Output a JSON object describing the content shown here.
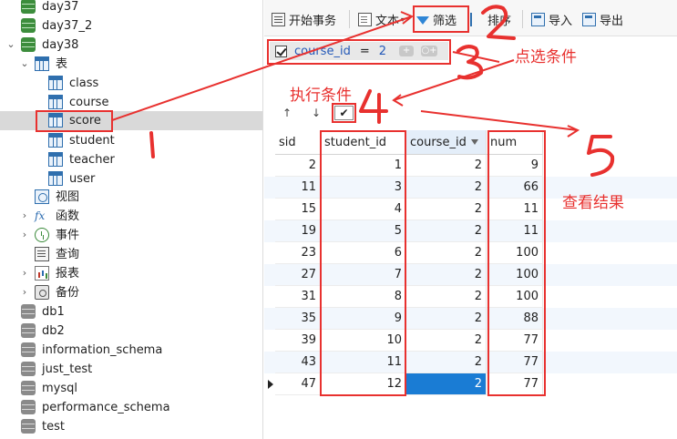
{
  "tree": {
    "items": [
      {
        "label": "day37",
        "icon": "database-icon"
      },
      {
        "label": "day37_2",
        "icon": "database-icon"
      },
      {
        "label": "day38",
        "icon": "database-icon"
      },
      {
        "label": "表",
        "icon": "table-icon"
      },
      {
        "label": "class",
        "icon": "table-icon"
      },
      {
        "label": "course",
        "icon": "table-icon"
      },
      {
        "label": "score",
        "icon": "table-icon"
      },
      {
        "label": "student",
        "icon": "table-icon"
      },
      {
        "label": "teacher",
        "icon": "table-icon"
      },
      {
        "label": "user",
        "icon": "table-icon"
      },
      {
        "label": "视图",
        "icon": "view-icon"
      },
      {
        "label": "函数",
        "icon": "function-icon"
      },
      {
        "label": "事件",
        "icon": "event-icon"
      },
      {
        "label": "查询",
        "icon": "query-icon"
      },
      {
        "label": "报表",
        "icon": "report-icon"
      },
      {
        "label": "备份",
        "icon": "backup-icon"
      },
      {
        "label": "db1",
        "icon": "database-icon"
      },
      {
        "label": "db2",
        "icon": "database-icon"
      },
      {
        "label": "information_schema",
        "icon": "database-icon"
      },
      {
        "label": "just_test",
        "icon": "database-icon"
      },
      {
        "label": "mysql",
        "icon": "database-icon"
      },
      {
        "label": "performance_schema",
        "icon": "database-icon"
      },
      {
        "label": "test",
        "icon": "database-icon"
      }
    ]
  },
  "toolbar": {
    "begin_transaction": "开始事务",
    "text": "文本",
    "filter": "筛选",
    "sort": "排序",
    "import": "导入",
    "export": "导出"
  },
  "filter": {
    "field": "course_id",
    "operator": "=",
    "value": "2",
    "add_label": "+",
    "add_group_label": "○+"
  },
  "nav": {
    "up": "↑",
    "down": "↓",
    "apply": "✔"
  },
  "grid": {
    "columns": [
      "sid",
      "student_id",
      "course_id",
      "num"
    ],
    "rows": [
      [
        "2",
        "1",
        "2",
        "9"
      ],
      [
        "11",
        "3",
        "2",
        "66"
      ],
      [
        "15",
        "4",
        "2",
        "11"
      ],
      [
        "19",
        "5",
        "2",
        "11"
      ],
      [
        "23",
        "6",
        "2",
        "100"
      ],
      [
        "27",
        "7",
        "2",
        "100"
      ],
      [
        "31",
        "8",
        "2",
        "100"
      ],
      [
        "35",
        "9",
        "2",
        "88"
      ],
      [
        "39",
        "10",
        "2",
        "77"
      ],
      [
        "43",
        "11",
        "2",
        "77"
      ],
      [
        "47",
        "12",
        "2",
        "77"
      ]
    ],
    "selected_row": 10,
    "selected_column": 2
  },
  "annotations": {
    "apply_condition": "执行条件",
    "click_condition": "点选条件",
    "view_result": "查看结果",
    "step1": "1",
    "step2": "2",
    "step3": "3",
    "step4": "4",
    "step5": "5",
    "color": "#e8312f"
  }
}
